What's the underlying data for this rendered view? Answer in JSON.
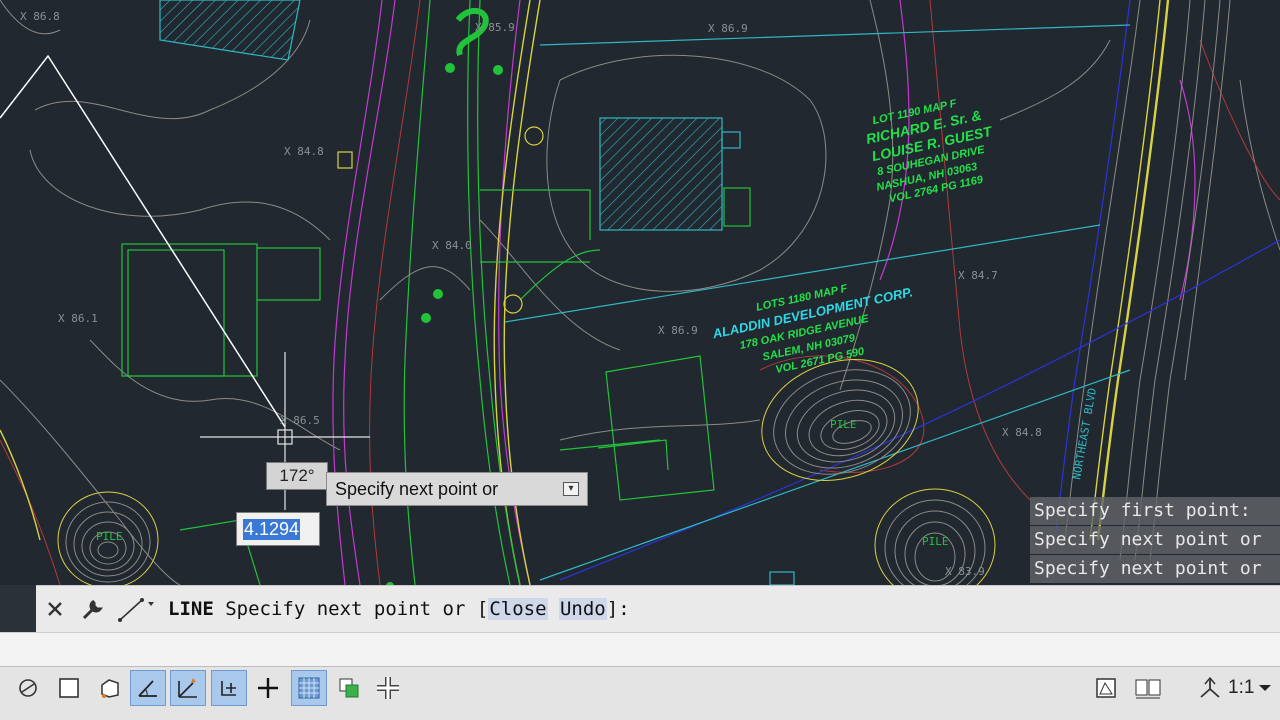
{
  "drawing": {
    "spot_elevations": [
      "X 86.9",
      "X 84.8",
      "X 86.1",
      "X 84.0",
      "X 86.9",
      "X 84.7",
      "X 85.9",
      "X 84.8",
      "X 86.8",
      "X 86.5",
      "X 83.9"
    ],
    "owners": [
      {
        "lines": [
          "LOT 1190    MAP F",
          "RICHARD E. Sr. &",
          "LOUISE R. GUEST",
          "8 SOUHEGAN DRIVE",
          "NASHUA, NH  03063",
          "VOL 2764   PG 1169"
        ]
      },
      {
        "lines": [
          "LOTS 1180    MAP F",
          "ALADDIN DEVELOPMENT CORP.",
          "178 OAK RIDGE AVENUE",
          "SALEM, NH  03079",
          "VOL 2671    PG 590"
        ]
      }
    ],
    "pile_labels": [
      "PILE",
      "PILE",
      "PILE"
    ],
    "road_label": "NORTHEAST BLVD"
  },
  "dynamic_input": {
    "angle": "172°",
    "prompt": "Specify next point or",
    "length": "4.1294"
  },
  "history": [
    "Specify first point:",
    "Specify next point or",
    "Specify next point or"
  ],
  "command_line": {
    "command": "LINE",
    "prompt": "Specify next point or [",
    "option_close": "Close",
    "option_undo": "Undo",
    "suffix": "]:"
  },
  "status_bar": {
    "scale": "1:1"
  },
  "colors": {
    "background": "#212830",
    "green": "#22c33a",
    "cyan": "#2fb8c4",
    "magenta": "#c23ad0",
    "yellow": "#d9d240",
    "contour": "#8c8a86"
  }
}
